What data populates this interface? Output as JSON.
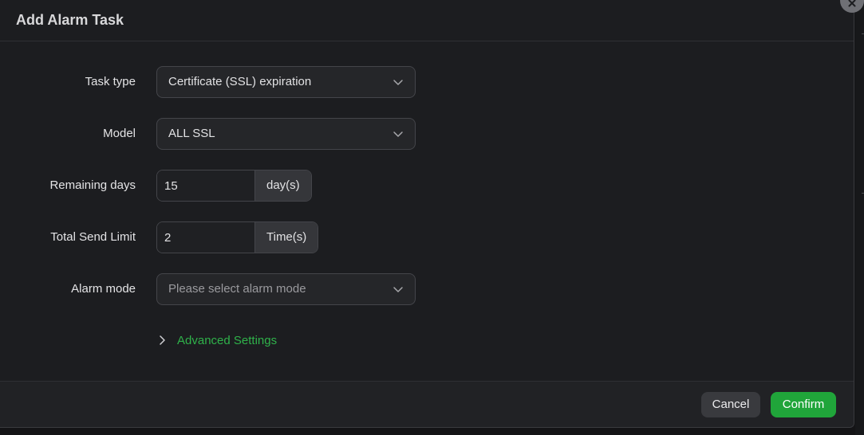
{
  "dialog": {
    "title": "Add Alarm Task",
    "close_icon": "close-icon"
  },
  "form": {
    "task_type": {
      "label": "Task type",
      "value": "Certificate (SSL) expiration"
    },
    "model": {
      "label": "Model",
      "value": "ALL SSL"
    },
    "remaining_days": {
      "label": "Remaining days",
      "value": "15",
      "unit": "day(s)"
    },
    "total_send_limit": {
      "label": "Total Send Limit",
      "value": "2",
      "unit": "Time(s)"
    },
    "alarm_mode": {
      "label": "Alarm mode",
      "placeholder": "Please select alarm mode"
    },
    "advanced_settings": {
      "label": "Advanced Settings"
    }
  },
  "footer": {
    "cancel_label": "Cancel",
    "confirm_label": "Confirm"
  },
  "colors": {
    "accent": "#20a53a",
    "link": "#2fb24a",
    "background": "#1c1d20"
  }
}
